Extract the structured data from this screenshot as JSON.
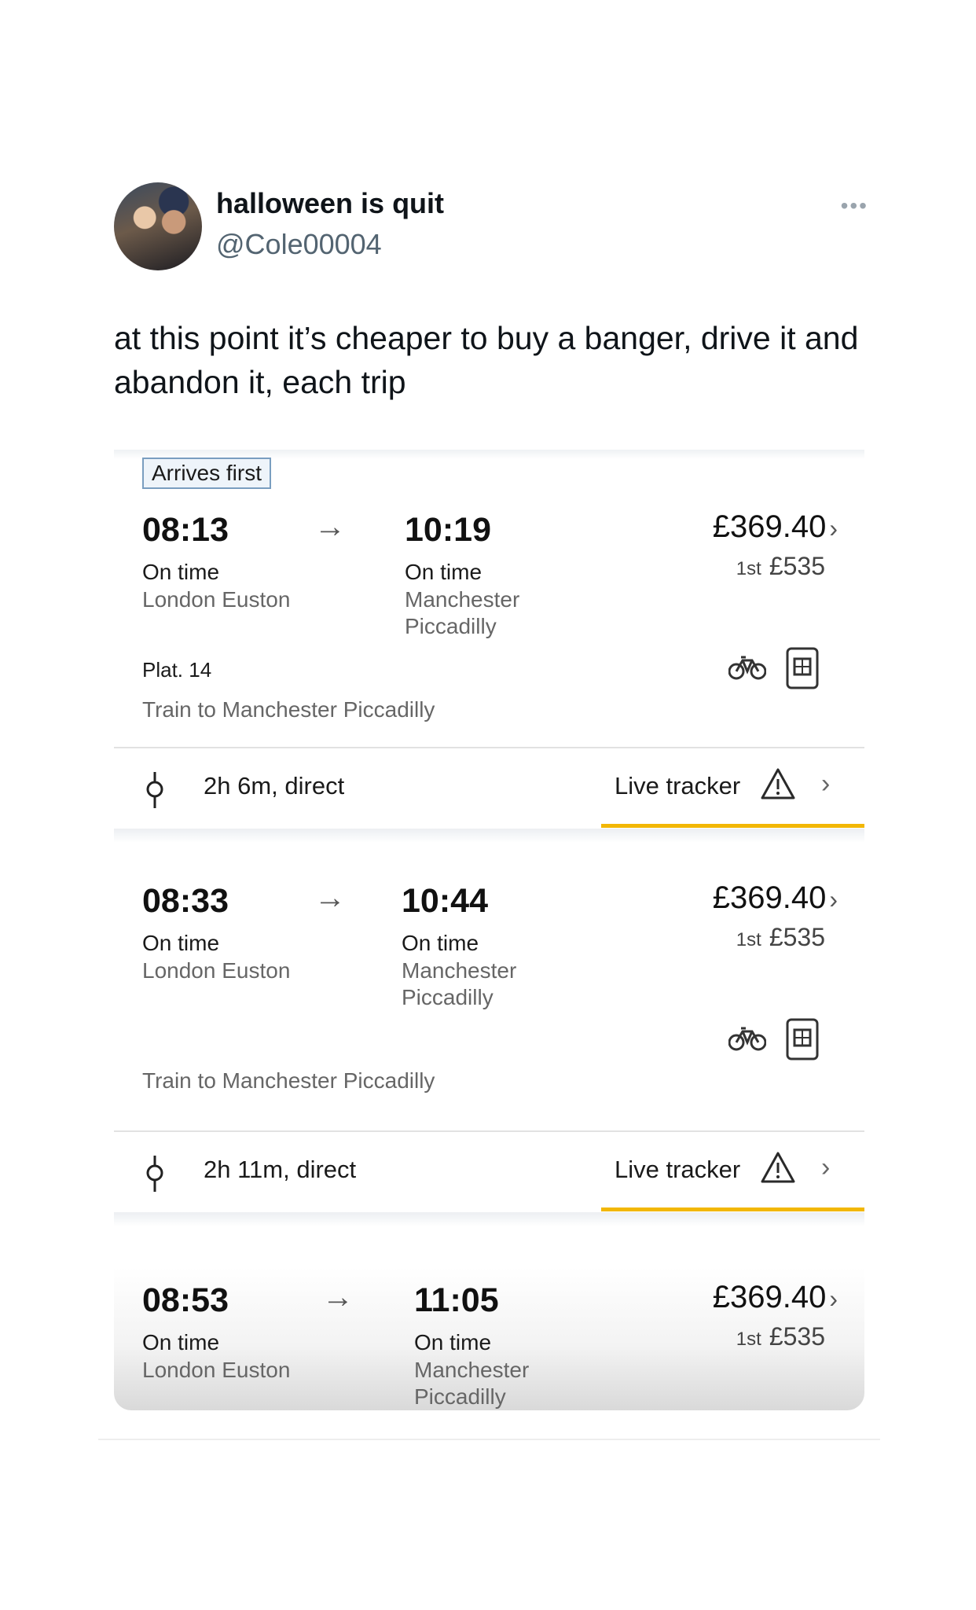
{
  "tweet": {
    "display_name": "halloween is quit",
    "handle": "@Cole00004",
    "more_label": "•••",
    "text": "at this point it’s cheaper to buy a banger, drive it and abandon it, each trip"
  },
  "journeys": [
    {
      "badge": "Arrives first",
      "depart_time": "08:13",
      "depart_status": "On time",
      "depart_station": "London Euston",
      "arrive_time": "10:19",
      "arrive_status": "On time",
      "arrive_station_line1": "Manchester",
      "arrive_station_line2": "Piccadilly",
      "price": "£369.40",
      "first_tag": "1st",
      "first_price": "£535",
      "platform": "Plat. 14",
      "destination": "Train to Manchester Piccadilly",
      "duration": "2h 6m, direct",
      "live_tracker": "Live tracker"
    },
    {
      "depart_time": "08:33",
      "depart_status": "On time",
      "depart_station": "London Euston",
      "arrive_time": "10:44",
      "arrive_status": "On time",
      "arrive_station_line1": "Manchester",
      "arrive_station_line2": "Piccadilly",
      "price": "£369.40",
      "first_tag": "1st",
      "first_price": "£535",
      "destination": "Train to Manchester Piccadilly",
      "duration": "2h 11m, direct",
      "live_tracker": "Live tracker"
    },
    {
      "depart_time": "08:53",
      "depart_status": "On time",
      "depart_station": "London Euston",
      "arrive_time": "11:05",
      "arrive_status": "On time",
      "arrive_station_line1": "Manchester",
      "arrive_station_line2": "Piccadilly",
      "price": "£369.40",
      "first_tag": "1st",
      "first_price": "£535"
    }
  ],
  "symbols": {
    "arrow": "→",
    "chevron": "›"
  },
  "colors": {
    "tracker_bar": "#f2b705",
    "badge_border": "#7a9ec0",
    "handle": "#536471"
  },
  "icons": [
    "bike-icon",
    "seat-reservation-icon",
    "stop-marker-icon",
    "warning-icon",
    "chevron-right-icon",
    "more-icon"
  ]
}
